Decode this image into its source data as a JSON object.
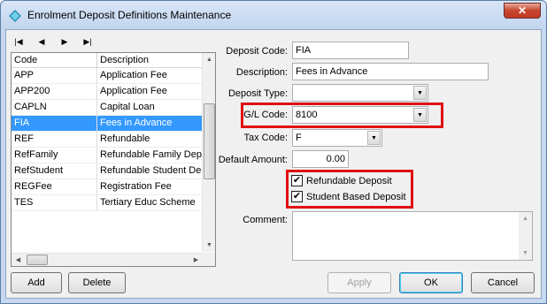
{
  "window": {
    "title": "Enrolment Deposit Definitions Maintenance",
    "close_label": "✕"
  },
  "nav": {
    "first": "|◀",
    "prev": "◀",
    "next": "▶",
    "last": "▶|"
  },
  "grid": {
    "columns": [
      "Code",
      "Description"
    ],
    "rows": [
      {
        "code": "APP",
        "description": "Application Fee"
      },
      {
        "code": "APP200",
        "description": "Application Fee"
      },
      {
        "code": "CAPLN",
        "description": "Capital Loan"
      },
      {
        "code": "FIA",
        "description": "Fees in Advance",
        "selected": true
      },
      {
        "code": "REF",
        "description": "Refundable"
      },
      {
        "code": "RefFamily",
        "description": "Refundable Family Depo"
      },
      {
        "code": "RefStudent",
        "description": "Refundable Student De"
      },
      {
        "code": "REGFee",
        "description": "Registration Fee"
      },
      {
        "code": "TES",
        "description": "Tertiary Educ Scheme"
      }
    ]
  },
  "form": {
    "deposit_code_label": "Deposit Code:",
    "deposit_code_value": "FIA",
    "description_label": "Description:",
    "description_value": "Fees in Advance",
    "deposit_type_label": "Deposit Type:",
    "deposit_type_value": "",
    "gl_code_label": "G/L Code:",
    "gl_code_value": "8100",
    "tax_code_label": "Tax Code:",
    "tax_code_value": "F",
    "default_amount_label": "Default Amount:",
    "default_amount_value": "0.00",
    "refundable_label": "Refundable Deposit",
    "refundable_checked": true,
    "student_based_label": "Student Based Deposit",
    "student_based_checked": true,
    "comment_label": "Comment:",
    "comment_value": ""
  },
  "buttons": {
    "add": "Add",
    "delete": "Delete",
    "apply": "Apply",
    "ok": "OK",
    "cancel": "Cancel"
  },
  "colors": {
    "highlight_box": "#e01010",
    "selection": "#3399ff"
  }
}
